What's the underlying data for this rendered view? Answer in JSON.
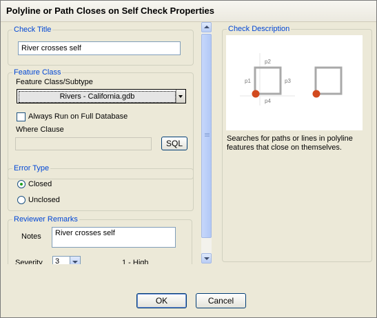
{
  "window": {
    "title": "Polyline or Path Closes on Self Check Properties"
  },
  "check_title": {
    "legend": "Check Title",
    "value": "River crosses self"
  },
  "feature_class": {
    "legend": "Feature Class",
    "subtype_label": "Feature Class/Subtype",
    "selected": "Rivers -  California.gdb",
    "always_run_label": "Always Run on Full Database",
    "always_run_checked": false,
    "where_label": "Where Clause",
    "where_value": "",
    "sql_label": "SQL"
  },
  "error_type": {
    "legend": "Error Type",
    "closed_label": "Closed",
    "unclosed_label": "Unclosed",
    "selected": "Closed"
  },
  "reviewer_remarks": {
    "legend": "Reviewer Remarks",
    "notes_label": "Notes",
    "notes_value": "River crosses self",
    "severity_label": "Severity",
    "severity_value": "3",
    "severity_hint": "1 - High"
  },
  "check_description": {
    "legend": "Check Description",
    "diagram_labels": {
      "p1": "p1",
      "p2": "p2",
      "p3": "p3",
      "p4": "p4"
    },
    "text": "Searches for paths or lines in polyline features that close on themselves."
  },
  "buttons": {
    "ok": "OK",
    "cancel": "Cancel"
  },
  "colors": {
    "accent": "#0046d5",
    "point": "#d24a1e",
    "shape": "#a9a9a9"
  }
}
